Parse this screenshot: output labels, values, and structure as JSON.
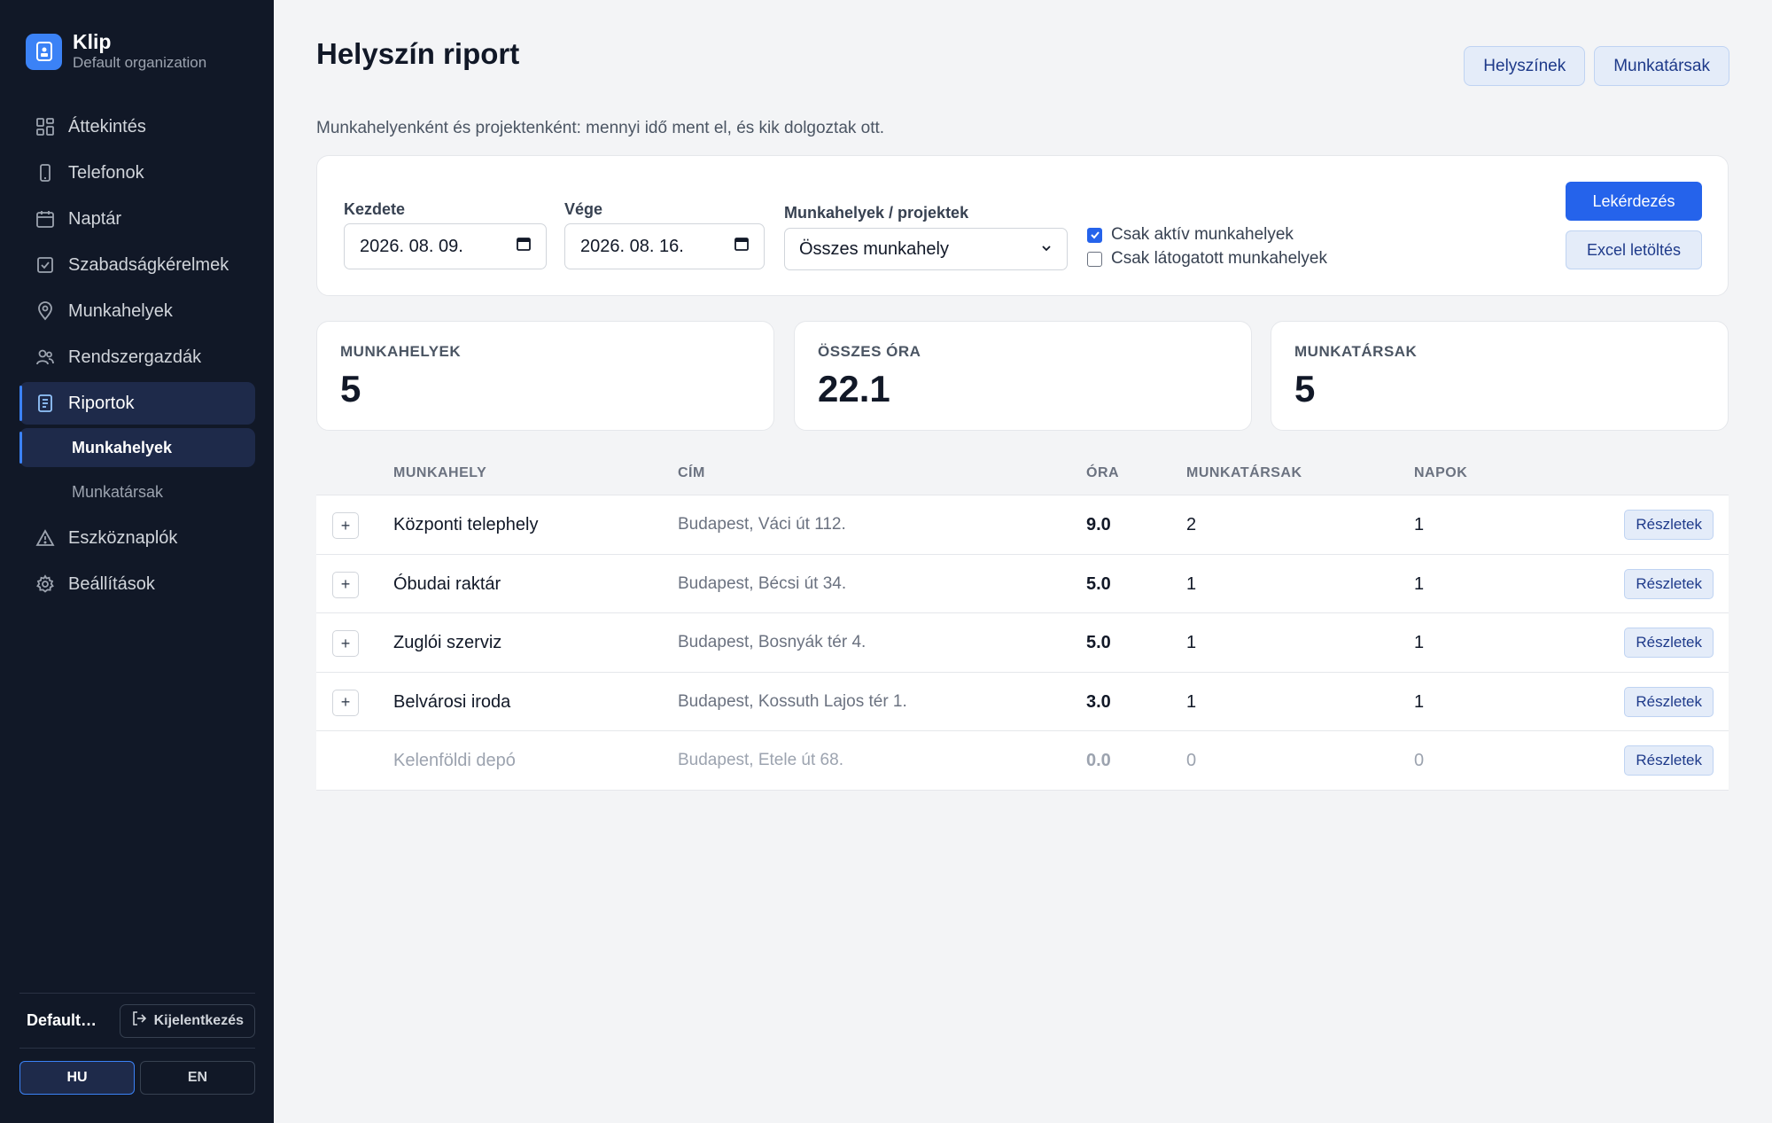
{
  "sidebar": {
    "brand_name": "Klip",
    "org_name": "Default organization",
    "items": [
      {
        "label": "Áttekintés",
        "icon": "dashboard-grid-icon"
      },
      {
        "label": "Telefonok",
        "icon": "phone-icon"
      },
      {
        "label": "Naptár",
        "icon": "calendar-icon"
      },
      {
        "label": "Szabadságkérelmek",
        "icon": "leave-request-icon"
      },
      {
        "label": "Munkahelyek",
        "icon": "map-pin-icon"
      },
      {
        "label": "Rendszergazdák",
        "icon": "users-icon"
      },
      {
        "label": "Riportok",
        "icon": "report-document-icon"
      },
      {
        "label": "Eszköznaplók",
        "icon": "warning-triangle-icon"
      },
      {
        "label": "Beállítások",
        "icon": "gear-icon"
      }
    ],
    "sub_items": [
      {
        "label": "Munkahelyek",
        "active": true
      },
      {
        "label": "Munkatársak",
        "active": false
      }
    ],
    "footer_user": "Default organization",
    "logout_label": "Kijelentkezés",
    "lang_hu": "HU",
    "lang_en": "EN"
  },
  "page": {
    "title": "Helyszín riport",
    "subtitle": "Munkahelyenként és projektenként: mennyi idő ment el, és kik dolgoztak ott.",
    "btn_locations": "Helyszínek",
    "btn_colleagues": "Munkatársak"
  },
  "filters": {
    "start_label": "Kezdete",
    "start_value": "2026. 08. 09.",
    "end_label": "Vége",
    "end_value": "2026. 08. 16.",
    "sites_label": "Munkahelyek / projektek",
    "sites_value": "Összes munkahely",
    "only_active_label": "Csak aktív munkahelyek",
    "only_active_checked": true,
    "only_visited_label": "Csak látogatott munkahelyek",
    "only_visited_checked": false,
    "query_button": "Lekérdezés",
    "excel_button": "Excel letöltés"
  },
  "stats": [
    {
      "label": "MUNKAHELYEK",
      "value": "5"
    },
    {
      "label": "ÖSSZES ÓRA",
      "value": "22.1"
    },
    {
      "label": "MUNKATÁRSAK",
      "value": "5"
    }
  ],
  "table": {
    "headers": {
      "site": "MUNKAHELY",
      "address": "CÍM",
      "hours": "ÓRA",
      "colleagues": "MUNKATÁRSAK",
      "days": "NAPOK"
    },
    "details_label": "Részletek",
    "rows": [
      {
        "site": "Központi telephely",
        "address": "Budapest, Váci út 112.",
        "hours": "9.0",
        "colleagues": "2",
        "days": "1",
        "expandable": true
      },
      {
        "site": "Óbudai raktár",
        "address": "Budapest, Bécsi út 34.",
        "hours": "5.0",
        "colleagues": "1",
        "days": "1",
        "expandable": true
      },
      {
        "site": "Zuglói szerviz",
        "address": "Budapest, Bosnyák tér 4.",
        "hours": "5.0",
        "colleagues": "1",
        "days": "1",
        "expandable": true
      },
      {
        "site": "Belvárosi iroda",
        "address": "Budapest, Kossuth Lajos tér 1.",
        "hours": "3.0",
        "colleagues": "1",
        "days": "1",
        "expandable": true
      },
      {
        "site": "Kelenföldi depó",
        "address": "Budapest, Etele út 68.",
        "hours": "0.0",
        "colleagues": "0",
        "days": "0",
        "expandable": false
      }
    ]
  },
  "colors": {
    "accent": "#2563eb",
    "sidebar_bg": "#111827",
    "page_bg": "#f3f4f6"
  }
}
